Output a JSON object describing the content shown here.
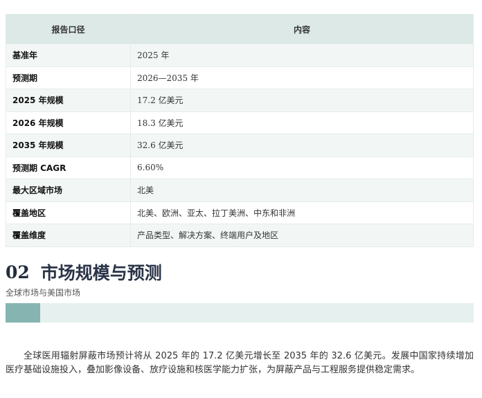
{
  "table": {
    "header": {
      "col1": "报告口径",
      "col2": "内容"
    },
    "rows": [
      {
        "label": "基准年",
        "value": "2025 年"
      },
      {
        "label": "预测期",
        "value": "2026—2035 年"
      },
      {
        "label": "2025 年规模",
        "value": "17.2 亿美元"
      },
      {
        "label": "2026 年规模",
        "value": "18.3 亿美元"
      },
      {
        "label": "2035 年规模",
        "value": "32.6 亿美元"
      },
      {
        "label": "预测期 CAGR",
        "value": "6.60%"
      },
      {
        "label": "最大区域市场",
        "value": "北美"
      },
      {
        "label": "覆盖地区",
        "value": "北美、欧洲、亚太、拉丁美洲、中东和非洲"
      },
      {
        "label": "覆盖维度",
        "value": "产品类型、解决方案、终端用户及地区"
      }
    ]
  },
  "section": {
    "number": "02",
    "title": "市场规模与预测",
    "subtitle": "全球市场与美国市场",
    "progress_fraction": 0.074
  },
  "paragraph": "全球医用辐射屏蔽市场预计将从 2025 年的 17.2 亿美元增长至 2035 年的 32.6 亿美元。发展中国家持续增加医疗基础设施投入，叠加影像设备、放疗设施和核医学能力扩张，为屏蔽产品与工程服务提供稳定需求。",
  "colors": {
    "header_bg": "#dde9e6",
    "row_alt_bg": "#f2f7f6",
    "progress_fill": "#86b5b1",
    "progress_track": "#e6f0ee",
    "heading_text": "#2a3447"
  }
}
